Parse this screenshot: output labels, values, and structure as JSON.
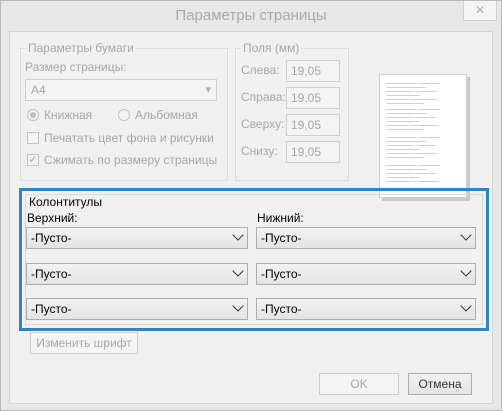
{
  "window": {
    "title": "Параметры страницы",
    "close_glyph": "✕"
  },
  "paper": {
    "group_label": "Параметры бумаги",
    "size_label": "Размер страницы:",
    "size_value": "A4",
    "orientation": {
      "portrait": "Книжная",
      "landscape": "Альбомная",
      "selected": "portrait"
    },
    "print_bg_label": "Печатать цвет фона и рисунки",
    "print_bg_checked": false,
    "shrink_label": "Сжимать по размеру страницы",
    "shrink_checked": true
  },
  "margins": {
    "group_label": "Поля (мм)",
    "left_label": "Слева:",
    "left_value": "19,05",
    "right_label": "Справа:",
    "right_value": "19,05",
    "top_label": "Сверху:",
    "top_value": "19,05",
    "bottom_label": "Снизу:",
    "bottom_value": "19,05"
  },
  "headers_footers": {
    "group_label": "Колонтитулы",
    "header_label": "Верхний:",
    "footer_label": "Нижний:",
    "header_values": [
      "-Пусто-",
      "-Пусто-",
      "-Пусто-"
    ],
    "footer_values": [
      "-Пусто-",
      "-Пусто-",
      "-Пусто-"
    ],
    "change_font_label": "Изменить шрифт"
  },
  "buttons": {
    "ok": "OK",
    "cancel": "Отмена"
  }
}
